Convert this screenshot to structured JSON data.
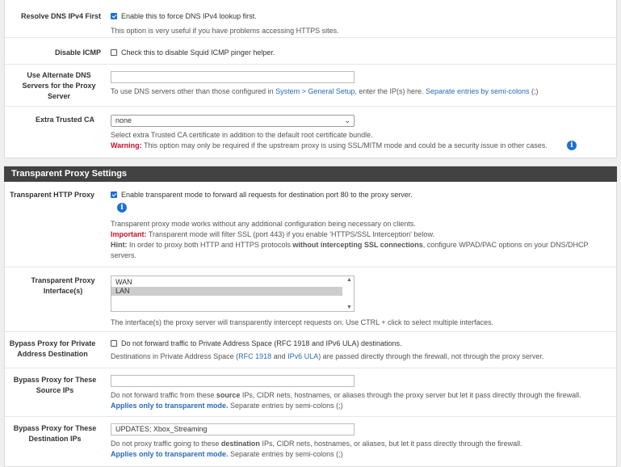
{
  "general": {
    "resolve_dns": {
      "label": "Resolve DNS IPv4 First",
      "checkbox_text": "Enable this to force DNS IPv4 lookup first.",
      "checked": true,
      "help": "This option is very useful if you have problems accessing HTTPS sites."
    },
    "disable_icmp": {
      "label": "Disable ICMP",
      "checkbox_text": "Check this to disable Squid ICMP pinger helper.",
      "checked": false
    },
    "alt_dns": {
      "label": "Use Alternate DNS Servers for the Proxy Server",
      "value": "",
      "help_pre": "To use DNS servers other than those configured in ",
      "help_link": "System > General Setup",
      "help_mid": ", enter the IP(s) here. ",
      "help_link2": "Separate entries by semi-colons",
      "help_post": " (;)"
    },
    "trusted_ca": {
      "label": "Extra Trusted CA",
      "selected": "none",
      "help": "Select extra Trusted CA certificate in addition to the default root certificate bundle.",
      "warning_label": "Warning:",
      "warning_text": " This option may only be required if the upstream proxy is using SSL/MITM mode and could be a security issue in other cases."
    }
  },
  "transparent": {
    "heading": "Transparent Proxy Settings",
    "http_proxy": {
      "label": "Transparent HTTP Proxy",
      "checkbox_text": "Enable transparent mode to forward all requests for destination port 80 to the proxy server.",
      "checked": true,
      "help1": "Transparent proxy mode works without any additional configuration being necessary on clients.",
      "important_label": "Important:",
      "important_text": " Transparent mode will filter SSL (port 443) if you enable 'HTTPS/SSL Interception' below.",
      "hint_label": "Hint:",
      "hint_pre": " In order to proxy both HTTP and HTTPS protocols ",
      "hint_bold": "without intercepting SSL connections",
      "hint_post": ", configure WPAD/PAC options on your DNS/DHCP servers."
    },
    "interfaces": {
      "label": "Transparent Proxy Interface(s)",
      "options": [
        "WAN",
        "LAN"
      ],
      "selected": "LAN",
      "help": "The interface(s) the proxy server will transparently intercept requests on. Use CTRL + click to select multiple interfaces."
    },
    "bypass_private": {
      "label": "Bypass Proxy for Private Address Destination",
      "checkbox_text": "Do not forward traffic to Private Address Space (RFC 1918 and IPv6 ULA) destinations.",
      "checked": false,
      "help_pre": "Destinations in Private Address Space (",
      "help_link1": "RFC 1918",
      "help_and": " and ",
      "help_link2": "IPv6 ULA",
      "help_post": ") are passed directly through the firewall, not through the proxy server."
    },
    "bypass_source": {
      "label": "Bypass Proxy for These Source IPs",
      "value": "",
      "help_pre": "Do not forward traffic from these ",
      "help_bold": "source",
      "help_post": " IPs, CIDR nets, hostnames, or aliases through the proxy server but let it pass directly through the firewall.",
      "applies": "Applies only to transparent mode.",
      "separate": " Separate entries by semi-colons (;)"
    },
    "bypass_dest": {
      "label": "Bypass Proxy for These Destination IPs",
      "value": "UPDATES; Xbox_Streaming",
      "help_pre": "Do not proxy traffic going to these ",
      "help_bold": "destination",
      "help_post": " IPs, CIDR nets, hostnames, or aliases, but let it pass directly through the firewall.",
      "applies": "Applies only to transparent mode.",
      "separate": " Separate entries by semi-colons (;)"
    }
  },
  "icons": {
    "info": "info-icon",
    "check": "check-icon",
    "chevron": "chevron-down-icon"
  },
  "colors": {
    "accent": "#1e6fd6",
    "heading_bg": "#424242",
    "warning": "#c8102e",
    "link": "#2a6bb7"
  }
}
